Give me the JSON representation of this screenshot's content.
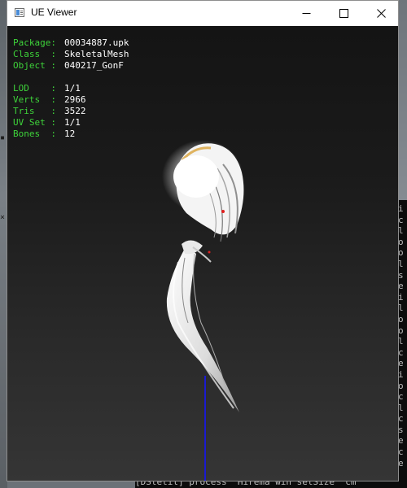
{
  "window": {
    "title": "UE Viewer",
    "controls": {
      "minimize": "minimize",
      "maximize": "maximize",
      "close": "close"
    }
  },
  "info": {
    "rows_top": [
      {
        "key": "Package",
        "value": "00034887.upk"
      },
      {
        "key": "Class  ",
        "value": "SkeletalMesh"
      },
      {
        "key": "Object ",
        "value": "040217_GonF"
      }
    ],
    "rows_bottom": [
      {
        "key": "LOD    ",
        "value": "1/1"
      },
      {
        "key": "Verts  ",
        "value": "2966"
      },
      {
        "key": "Tris   ",
        "value": "3522"
      },
      {
        "key": "UV Set ",
        "value": "1/1"
      },
      {
        "key": "Bones  ",
        "value": "12"
      }
    ]
  },
  "background_console": {
    "bottom_line": "[DStetil] process  Hirema win setSize  cm"
  },
  "colors": {
    "label_green": "#3ed33a",
    "value_white": "#ffffff",
    "axis_blue": "#1a1ad0"
  }
}
